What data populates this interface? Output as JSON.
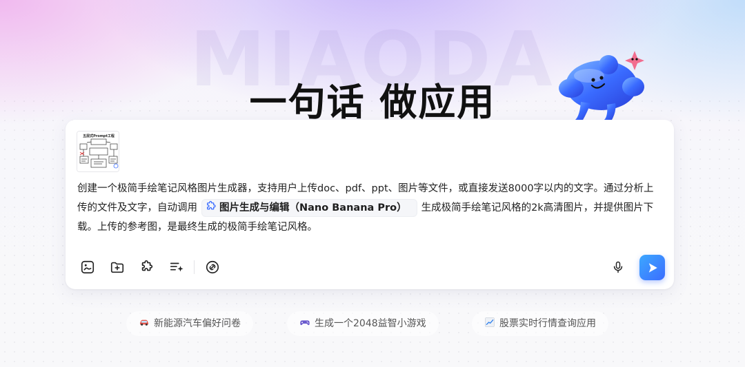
{
  "hero": {
    "watermark": "MIAODA",
    "title": "一句话 做应用"
  },
  "composer": {
    "attachment_title": "五层式Prompt工程",
    "prompt_before": "创建一个极简手绘笔记风格图片生成器，支持用户上传doc、pdf、ppt、图片等文件，或直接发送8000字以内的文字。通过分析上传的文件及文字，自动调用",
    "plugin_chip": "图片生成与编辑（Nano Banana Pro）",
    "prompt_after": "生成极简手绘笔记风格的2k高清图片，并提供图片下载。上传的参考图，是最终生成的极简手绘笔记风格。",
    "toolbar_icons": [
      "image-upload-icon",
      "file-add-icon",
      "plugin-icon",
      "prompt-enhance-icon",
      "link-icon"
    ],
    "mic_icon": "microphone-icon",
    "send_icon": "send-icon",
    "accent": "#3b6dff"
  },
  "suggestions": [
    {
      "icon": "car-icon",
      "label": "新能源汽车偏好问卷"
    },
    {
      "icon": "gamepad-icon",
      "label": "生成一个2048益智小游戏"
    },
    {
      "icon": "chart-up-icon",
      "label": "股票实时行情查询应用"
    }
  ]
}
